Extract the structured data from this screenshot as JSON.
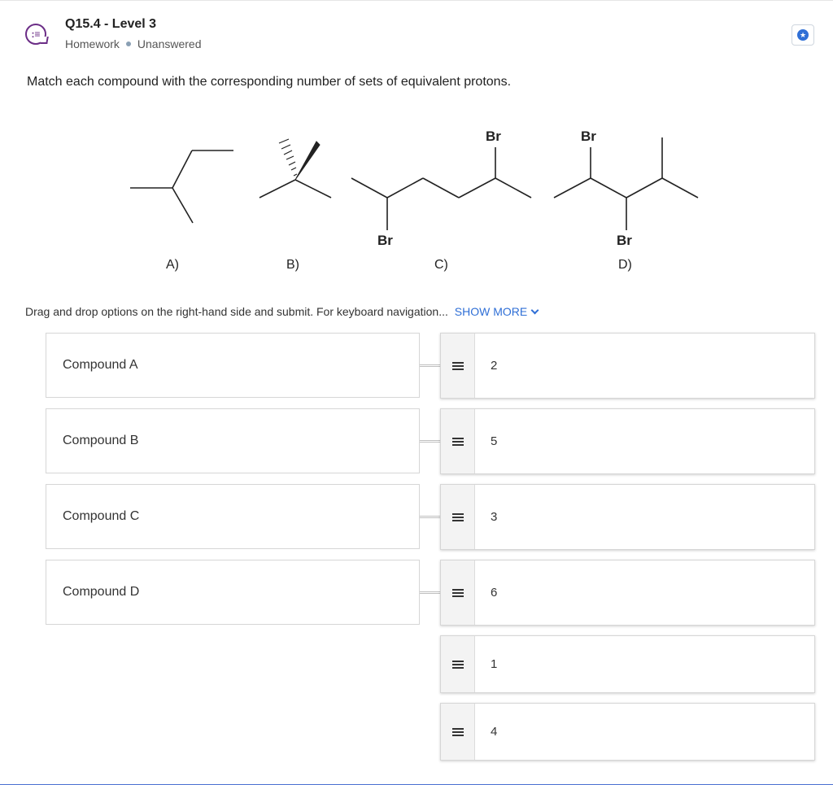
{
  "header": {
    "icon": "list-chat-icon",
    "title": "Q15.4 - Level 3",
    "type": "Homework",
    "status": "Unanswered",
    "bookmark_icon": "star-badge-icon"
  },
  "prompt": "Match each compound with the corresponding number of sets of equivalent protons.",
  "structures": {
    "labels": [
      "A)",
      "B)",
      "C)",
      "D)"
    ],
    "substituent": "Br"
  },
  "instructions": {
    "text": "Drag and drop options on the right-hand side and submit. For keyboard navigation...",
    "show_more": "SHOW MORE"
  },
  "drop_targets": [
    "Compound A",
    "Compound B",
    "Compound C",
    "Compound D"
  ],
  "options": [
    "2",
    "5",
    "3",
    "6",
    "1",
    "4"
  ],
  "colors": {
    "accent": "#2f6fd6",
    "icon_purple": "#6b2d86",
    "bottom_border": "#4a6fd1"
  }
}
